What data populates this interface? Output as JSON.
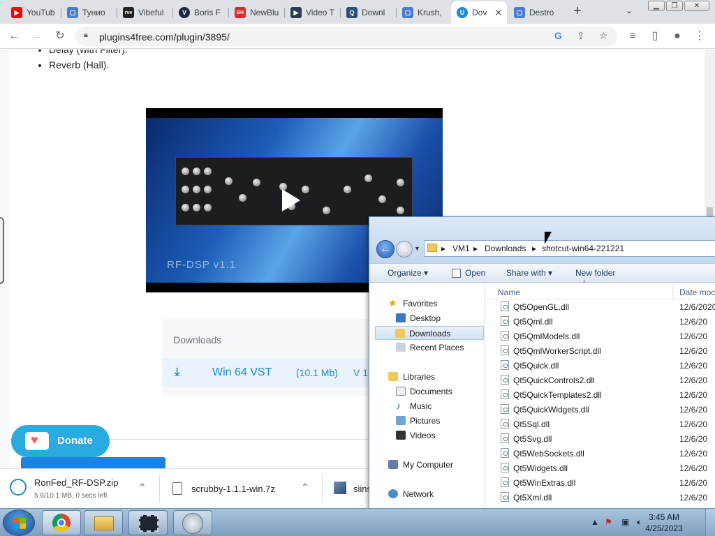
{
  "browser": {
    "tabs": [
      {
        "title": "YouTub",
        "favicon": "youtube-icon",
        "color": "#ff0000"
      },
      {
        "title": "Тунио",
        "favicon": "page-icon",
        "color": "#4a7bd0"
      },
      {
        "title": "Vibeful",
        "favicon": "vibeful-icon",
        "color": "#222222"
      },
      {
        "title": "Boris F",
        "favicon": "v-icon",
        "color": "#1b2a41"
      },
      {
        "title": "NewBlu",
        "favicon": "newblue-icon",
        "color": "#d62e2e"
      },
      {
        "title": "Video T",
        "favicon": "play-icon",
        "color": "#2b3a55"
      },
      {
        "title": "Downl",
        "favicon": "q-icon",
        "color": "#2d4f79"
      },
      {
        "title": "Krush,",
        "favicon": "page-icon",
        "color": "#4a7bd0"
      },
      {
        "title": "Dov",
        "favicon": "u-icon",
        "color": "#1d8ad4"
      },
      {
        "title": "Destro",
        "favicon": "page-icon",
        "color": "#4a7bd0"
      }
    ],
    "url": "plugins4free.com/plugin/3895/"
  },
  "page": {
    "effects": [
      "Delay (with Filter).",
      "Reverb (Hall)."
    ],
    "video_title": "RF-DSP v1.1",
    "downloads": {
      "title": "Downloads",
      "item": {
        "name": "Win 64 VST",
        "size": "(10.1 Mb)",
        "version": "V 1"
      }
    },
    "donate_label": "Donate"
  },
  "download_shelf": [
    {
      "name": "RonFed_RF-DSP.zip",
      "status": "5.6/10.1 MB, 0 secs left"
    },
    {
      "name": "scrubby-1.1.1-win.7z",
      "status": ""
    },
    {
      "name": "siins",
      "status": ""
    }
  ],
  "explorer": {
    "path": [
      "VM1",
      "Downloads",
      "shotcut-win64-221221"
    ],
    "commands": [
      "Organize",
      "Open",
      "Share with",
      "New folder"
    ],
    "nav": {
      "favorites": {
        "label": "Favorites",
        "items": [
          "Desktop",
          "Downloads",
          "Recent Places"
        ]
      },
      "libraries": {
        "label": "Libraries",
        "items": [
          "Documents",
          "Music",
          "Pictures",
          "Videos"
        ]
      },
      "computer": "My Computer",
      "network": "Network"
    },
    "columns": {
      "name": "Name",
      "date": "Date moc"
    },
    "files": [
      {
        "name": "Qt5OpenGL.dll",
        "date": "12/6/2020"
      },
      {
        "name": "Qt5Qml.dll",
        "date": "12/6/20"
      },
      {
        "name": "Qt5QmlModels.dll",
        "date": "12/6/20"
      },
      {
        "name": "Qt5QmlWorkerScript.dll",
        "date": "12/6/20"
      },
      {
        "name": "Qt5Quick.dll",
        "date": "12/6/20"
      },
      {
        "name": "Qt5QuickControls2.dll",
        "date": "12/6/20"
      },
      {
        "name": "Qt5QuickTemplates2.dll",
        "date": "12/6/20"
      },
      {
        "name": "Qt5QuickWidgets.dll",
        "date": "12/6/20"
      },
      {
        "name": "Qt5Sql.dll",
        "date": "12/6/20"
      },
      {
        "name": "Qt5Svg.dll",
        "date": "12/6/20"
      },
      {
        "name": "Qt5WebSockets.dll",
        "date": "12/6/20"
      },
      {
        "name": "Qt5Widgets.dll",
        "date": "12/6/20"
      },
      {
        "name": "Qt5WinExtras.dll",
        "date": "12/6/20"
      },
      {
        "name": "Qt5Xml.dll",
        "date": "12/6/20"
      }
    ]
  },
  "taskbar": {
    "time": "3:45 AM",
    "date": "4/25/2023"
  }
}
